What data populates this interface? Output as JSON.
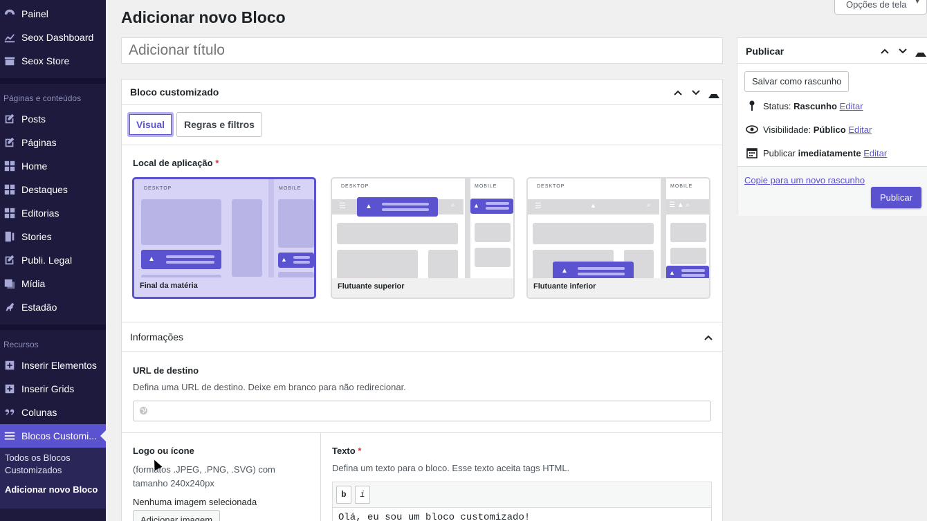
{
  "sidebar": {
    "items_top": [
      {
        "label": "Painel",
        "icon": "dashboard-icon"
      },
      {
        "label": "Seox Dashboard",
        "icon": "chart-icon"
      },
      {
        "label": "Seox Store",
        "icon": "store-icon"
      }
    ],
    "section_pages": "Páginas e conteúdos",
    "items_pages": [
      {
        "label": "Posts",
        "icon": "edit-icon"
      },
      {
        "label": "Páginas",
        "icon": "edit-icon"
      },
      {
        "label": "Home",
        "icon": "grid-icon"
      },
      {
        "label": "Destaques",
        "icon": "grid-icon"
      },
      {
        "label": "Editorias",
        "icon": "grid-icon"
      },
      {
        "label": "Stories",
        "icon": "stories-icon"
      },
      {
        "label": "Publi. Legal",
        "icon": "edit-icon"
      },
      {
        "label": "Mídia",
        "icon": "media-icon"
      },
      {
        "label": "Estadão",
        "icon": "horse-icon"
      }
    ],
    "section_resources": "Recursos",
    "items_resources": [
      {
        "label": "Inserir Elementos",
        "icon": "plus-box-icon"
      },
      {
        "label": "Inserir Grids",
        "icon": "plus-box-icon"
      },
      {
        "label": "Colunas",
        "icon": "quote-icon"
      },
      {
        "label": "Blocos Customi...",
        "icon": "list-icon"
      }
    ],
    "submenu": [
      "Todos os Blocos Customizados",
      "Adicionar novo Bloco"
    ],
    "accent_color": "#5b52d0"
  },
  "page": {
    "title": "Adicionar novo Bloco",
    "screen_options": "Opções de tela",
    "title_placeholder": "Adicionar título"
  },
  "block": {
    "header": "Bloco customizado",
    "tabs": [
      "Visual",
      "Regras e filtros"
    ],
    "location_label": "Local de aplicação",
    "required_mark": "*",
    "cards": [
      {
        "caption": "Final da matéria",
        "desktop": "DESKTOP",
        "mobile": "MOBILE"
      },
      {
        "caption": "Flutuante superior",
        "desktop": "DESKTOP",
        "mobile": "MOBILE"
      },
      {
        "caption": "Flutuante inferior",
        "desktop": "DESKTOP",
        "mobile": "MOBILE"
      }
    ],
    "info_header": "Informações",
    "url_label": "URL de destino",
    "url_desc": "Defina uma URL de destino. Deixe em branco para não redirecionar.",
    "url_value": "",
    "logo_label": "Logo ou ícone",
    "logo_desc": "(formatos .JPEG, .PNG, .SVG) com tamanho 240x240px",
    "logo_none": "Nenhuma imagem selecionada",
    "logo_button": "Adicionar imagem",
    "text_label": "Texto",
    "text_desc": "Defina um texto para o bloco. Esse texto aceita tags HTML.",
    "bold_btn": "b",
    "italic_btn": "i",
    "text_value": "Olá, eu sou um bloco customizado!"
  },
  "publish": {
    "header": "Publicar",
    "save_draft": "Salvar como rascunho",
    "status_label": "Status:",
    "status_value": "Rascunho",
    "visibility_label": "Visibilidade:",
    "visibility_value": "Público",
    "publish_label": "Publicar",
    "publish_value": "imediatamente",
    "edit": "Editar",
    "copy_draft": "Copie para um novo rascunho",
    "publish_button": "Publicar"
  }
}
